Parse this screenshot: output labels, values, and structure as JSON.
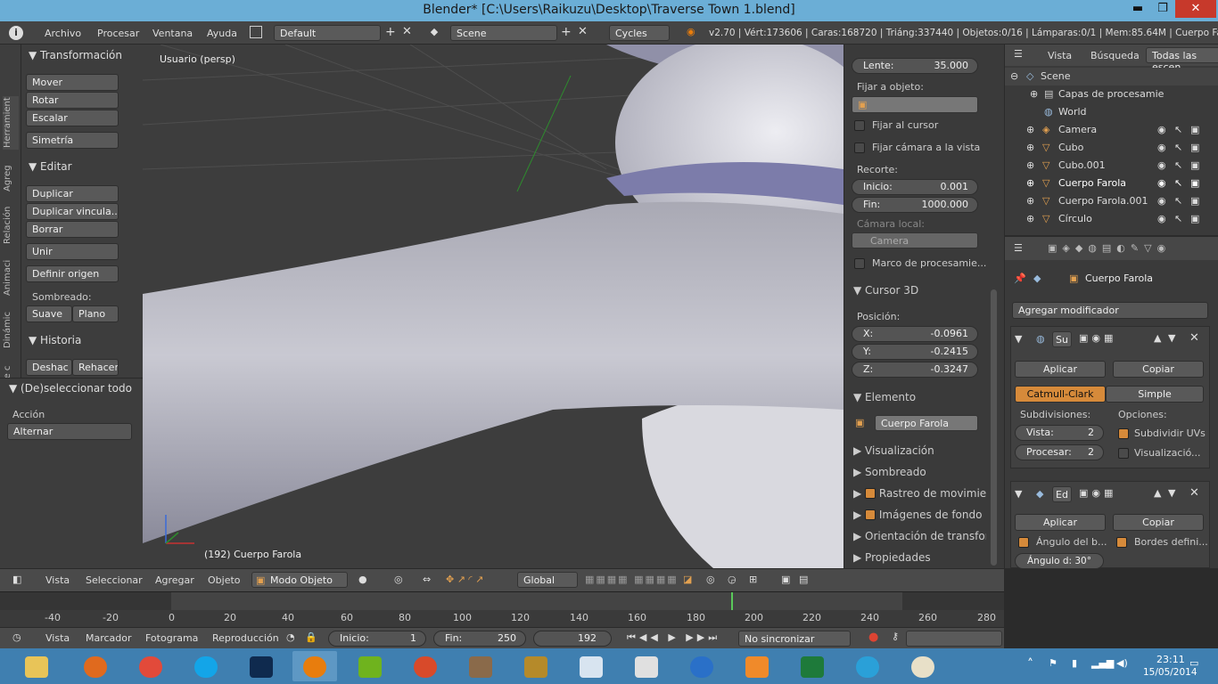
{
  "window": {
    "title": "Blender* [C:\\Users\\Raikuzu\\Desktop\\Traverse Town 1.blend]",
    "minimize": "▬",
    "restore": "❐",
    "close": "✕"
  },
  "menubar": {
    "items": [
      "Archivo",
      "Procesar",
      "Ventana",
      "Ayuda"
    ],
    "layout": "Default",
    "scene": "Scene",
    "engine": "Cycles",
    "stats": "v2.70 | Vért:173606 | Caras:168720 | Triáng:337440 | Objetos:0/16 | Lámparas:0/1 | Mem:85.64M | Cuerpo Farola"
  },
  "toolshelf": {
    "tabs": [
      "Herramient",
      "Agreg",
      "Relación",
      "Animaci",
      "Dinámic",
      "Lápiz de c"
    ],
    "transform_header": "Transformación",
    "transform_buttons": [
      "Mover",
      "Rotar",
      "Escalar"
    ],
    "symmetry": "Simetría",
    "edit_header": "Editar",
    "edit_buttons": [
      "Duplicar",
      "Duplicar vincula...",
      "Borrar"
    ],
    "join": "Unir",
    "set_origin": "Definir origen",
    "shading_label": "Sombreado:",
    "smooth": "Suave",
    "flat": "Plano",
    "history_header": "Historia",
    "undo": "Deshac",
    "redo": "Rehacer",
    "operator_header": "(De)seleccionar todo",
    "action_label": "Acción",
    "action_value": "Alternar"
  },
  "viewport": {
    "view_name": "Usuario (persp)",
    "object_info": "(192) Cuerpo Farola"
  },
  "npanel": {
    "lens_label": "Lente:",
    "lens_value": "35.000",
    "lock_label": "Fijar a objeto:",
    "lock_cursor": "Fijar al cursor",
    "lock_camera": "Fijar cámara a la vista",
    "clip_label": "Recorte:",
    "clip_start_k": "Inicio:",
    "clip_start_v": "0.001",
    "clip_end_k": "Fin:",
    "clip_end_v": "1000.000",
    "local_camera_label": "Cámara local:",
    "local_camera": "Camera",
    "render_border": "Marco de procesamie...",
    "cursor_header": "Cursor 3D",
    "position_label": "Posición:",
    "cx_k": "X:",
    "cx_v": "-0.0961",
    "cy_k": "Y:",
    "cy_v": "-0.2415",
    "cz_k": "Z:",
    "cz_v": "-0.3247",
    "item_header": "Elemento",
    "item_name": "Cuerpo Farola",
    "collapsed": [
      "Visualización",
      "Sombreado",
      "Rastreo de movimien",
      "Imágenes de fondo",
      "Orientación de transform",
      "Propiedades"
    ]
  },
  "outliner": {
    "menus": [
      "Vista",
      "Búsqueda"
    ],
    "filter": "Todas las escen",
    "rows": [
      {
        "name": "Scene"
      },
      {
        "name": "Capas de procesamie"
      },
      {
        "name": "World"
      },
      {
        "name": "Camera"
      },
      {
        "name": "Cubo"
      },
      {
        "name": "Cubo.001"
      },
      {
        "name": "Cuerpo Farola"
      },
      {
        "name": "Cuerpo Farola.001"
      },
      {
        "name": "Círculo"
      }
    ]
  },
  "properties": {
    "object_name": "Cuerpo Farola",
    "add_modifier": "Agregar modificador",
    "mod1": {
      "name": "Su",
      "apply": "Aplicar",
      "copy": "Copiar",
      "tab_a": "Catmull-Clark",
      "tab_b": "Simple",
      "subdiv_label": "Subdivisiones:",
      "options_label": "Opciones:",
      "view_k": "Vista:",
      "view_v": "2",
      "render_k": "Procesar:",
      "render_v": "2",
      "uv": "Subdividir UVs",
      "opt2": "Visualizació..."
    },
    "mod2": {
      "name": "Ed",
      "apply": "Aplicar",
      "copy": "Copiar",
      "angle": "Ángulo del b...",
      "edges": "Bordes defini...",
      "angle_value": "Ángulo d: 30°"
    }
  },
  "view_header": {
    "menus": [
      "Vista",
      "Seleccionar",
      "Agregar",
      "Objeto"
    ],
    "mode": "Modo Objeto",
    "orientation": "Global"
  },
  "timeline": {
    "ticks": [
      "-40",
      "-20",
      "0",
      "20",
      "40",
      "60",
      "80",
      "100",
      "120",
      "140",
      "160",
      "180",
      "200",
      "220",
      "240",
      "260",
      "280"
    ],
    "current": 192
  },
  "timeline_header": {
    "menus": [
      "Vista",
      "Marcador",
      "Fotograma",
      "Reproducción"
    ],
    "start_k": "Inicio:",
    "start_v": "1",
    "end_k": "Fin:",
    "end_v": "250",
    "frame": "192",
    "sync": "No sincronizar"
  },
  "taskbar": {
    "time": "23:11",
    "date": "15/05/2014"
  },
  "colors": {
    "accent": "#d68a3a",
    "titlebar": "#6baed6",
    "taskbar": "#3f7fb0",
    "close": "#c7392b"
  }
}
